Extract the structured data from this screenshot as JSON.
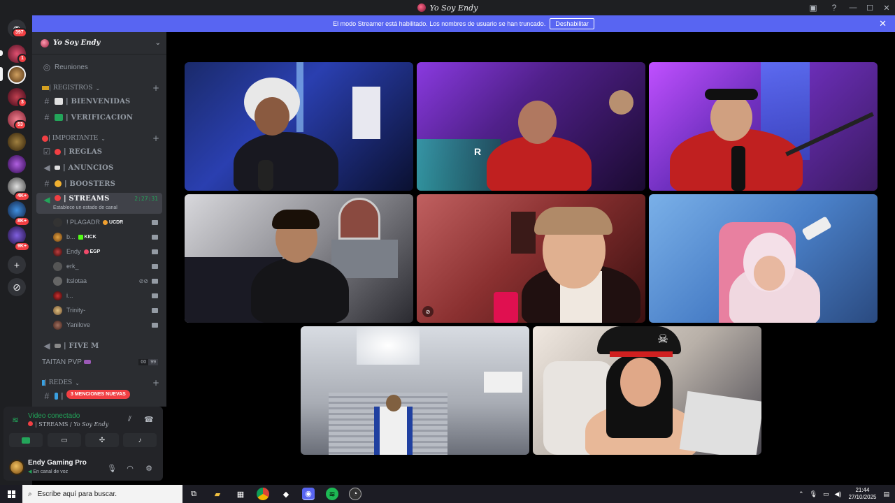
{
  "window": {
    "title": "Yo Soy Endy"
  },
  "banner": {
    "text": "El modo Streamer está habilitado. Los nombres de usuario se han truncado.",
    "button": "Deshabilitar"
  },
  "rail": {
    "home_badge": "397",
    "badges": [
      "1",
      "3",
      "53",
      "4K+",
      "8K+",
      "9K+"
    ]
  },
  "guild": {
    "name": "Yo Soy Endy",
    "reuniones": "Reuniones",
    "categories": {
      "registros": "| REGISTROS",
      "importante": "| IMPORTANTE",
      "redes": "| REDES"
    },
    "channels": {
      "bienvenidas": "| BIENVENIDAS",
      "verificacion": "| VERIFICACION",
      "reglas": "| REGLAS",
      "anuncios": "| ANUNCIOS",
      "boosters": "| BOOSTERS",
      "streams": "| STREAMS",
      "streams_time": "2:27:31",
      "streams_status": "Establece un estado de canal",
      "fivem": "| FIVE M",
      "taitan": "TAITAN PVP",
      "taitan_count_a": "00",
      "taitan_count_b": "99"
    },
    "voice_users": [
      {
        "name": "! PLAGADR",
        "tag": "UCDR",
        "tag_color": "#f0a030"
      },
      {
        "name": "b...",
        "tag": "KICK",
        "tag_color": "#53fc18"
      },
      {
        "name": "Endy",
        "tag": "EGP",
        "tag_color": "#f04a6a"
      },
      {
        "name": "erk_",
        "tag": "",
        "tag_color": ""
      },
      {
        "name": "Itslotaa",
        "tag": "",
        "tag_color": ""
      },
      {
        "name": "i...",
        "tag": "",
        "tag_color": ""
      },
      {
        "name": "Trinity-",
        "tag": "",
        "tag_color": ""
      },
      {
        "name": "Yanilove",
        "tag": "",
        "tag_color": ""
      }
    ],
    "mentions": "3 MENCIONES NUEVAS"
  },
  "voice_panel": {
    "status": "Video conectado",
    "channel": "| STREAMS / ",
    "guild": "Yo Soy Endy"
  },
  "user": {
    "name": "Endy Gaming Pro",
    "status": "En canal de voz"
  },
  "taskbar": {
    "search_placeholder": "Escribe aquí para buscar.",
    "time": "21:44",
    "date": "27/10/2025"
  },
  "colors": {
    "accent": "#5865f2",
    "online": "#23a55a",
    "danger": "#f23f43"
  }
}
